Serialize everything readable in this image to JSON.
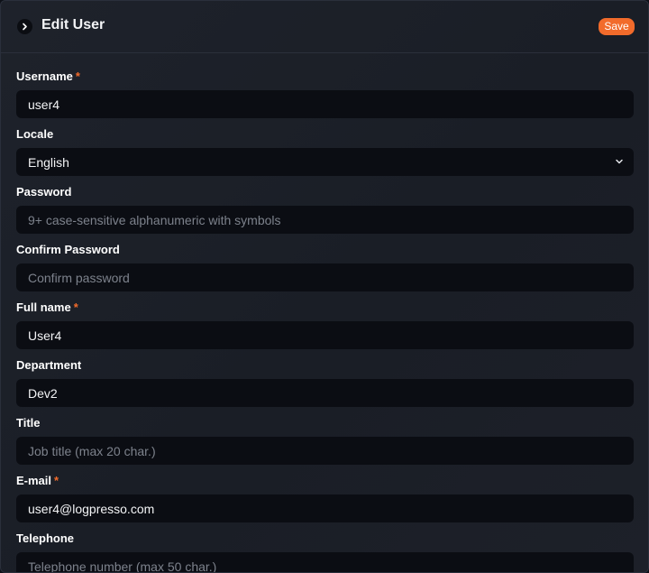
{
  "header": {
    "title": "Edit User",
    "save_label": "Save"
  },
  "colors": {
    "accent": "#f26b2b",
    "panel_bg": "#1e222b",
    "field_bg": "#0b0d13"
  },
  "icons": {
    "toggle": "chevron-right-icon",
    "select": "chevron-down-icon"
  },
  "form": {
    "username": {
      "label": "Username",
      "required": "*",
      "value": "user4",
      "placeholder": ""
    },
    "locale": {
      "label": "Locale",
      "value": "English"
    },
    "password": {
      "label": "Password",
      "value": "",
      "placeholder": "9+ case-sensitive alphanumeric with symbols"
    },
    "confirm_password": {
      "label": "Confirm Password",
      "value": "",
      "placeholder": "Confirm password"
    },
    "full_name": {
      "label": "Full name",
      "required": "*",
      "value": "User4",
      "placeholder": ""
    },
    "department": {
      "label": "Department",
      "value": "Dev2",
      "placeholder": ""
    },
    "title": {
      "label": "Title",
      "value": "",
      "placeholder": "Job title (max 20 char.)"
    },
    "email": {
      "label": "E-mail",
      "required": "*",
      "value": "user4@logpresso.com",
      "placeholder": ""
    },
    "telephone": {
      "label": "Telephone",
      "value": "",
      "placeholder": "Telephone number (max 50 char.)"
    }
  }
}
